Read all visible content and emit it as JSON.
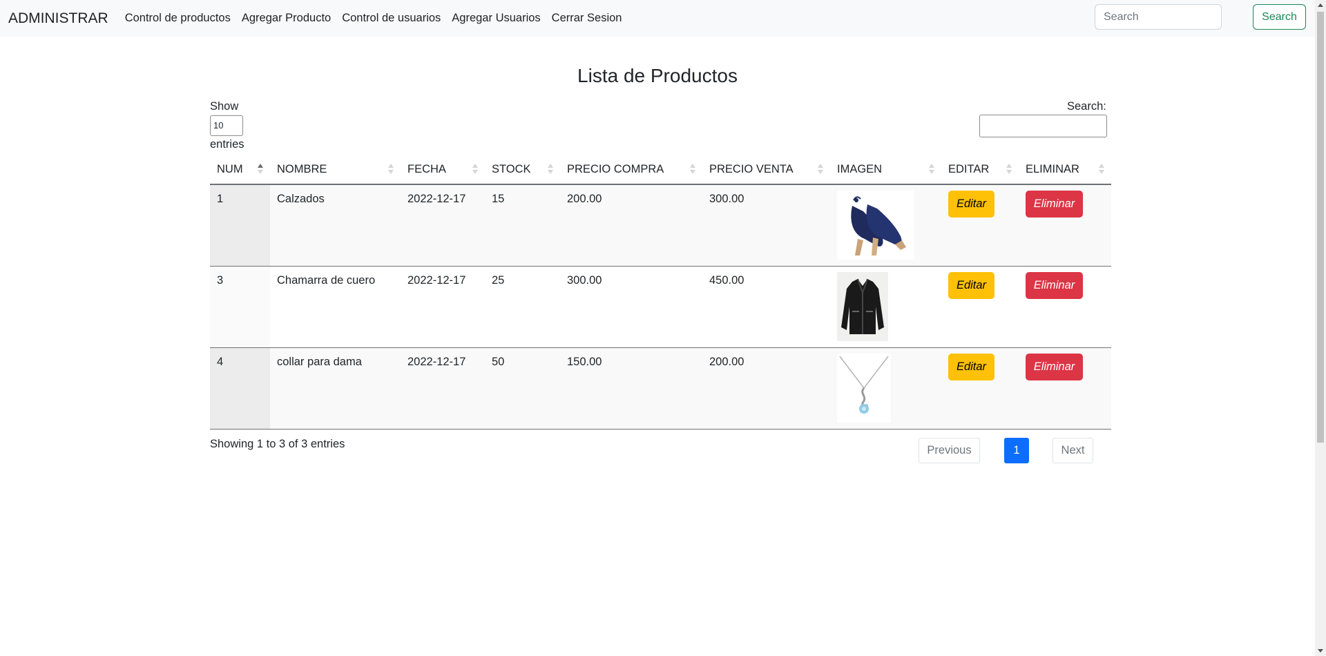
{
  "navbar": {
    "brand": "ADMINISTRAR",
    "links": [
      "Control de productos",
      "Agregar Producto",
      "Control de usuarios",
      "Agregar Usuarios",
      "Cerrar Sesion"
    ],
    "search_placeholder": "Search",
    "search_button": "Search"
  },
  "page": {
    "title": "Lista de Productos"
  },
  "datatable": {
    "length_label_before": "Show",
    "length_value": "10",
    "length_label_after": "entries",
    "search_label": "Search:",
    "columns": [
      "NUM",
      "NOMBRE",
      "FECHA",
      "STOCK",
      "PRECIO COMPRA",
      "PRECIO VENTA",
      "IMAGEN",
      "EDITAR",
      "ELIMINAR"
    ],
    "sorted_column": "NUM",
    "sort_direction": "ascending",
    "rows": [
      {
        "num": "1",
        "nombre": "Calzados",
        "fecha": "2022-12-17",
        "stock": "15",
        "precio_compra": "200.00",
        "precio_venta": "300.00",
        "image_icon": "high-heel-shoes-icon",
        "edit": "Editar",
        "delete": "Eliminar"
      },
      {
        "num": "3",
        "nombre": "Chamarra de cuero",
        "fecha": "2022-12-17",
        "stock": "25",
        "precio_compra": "300.00",
        "precio_venta": "450.00",
        "image_icon": "leather-jacket-icon",
        "edit": "Editar",
        "delete": "Eliminar"
      },
      {
        "num": "4",
        "nombre": "collar para dama",
        "fecha": "2022-12-17",
        "stock": "50",
        "precio_compra": "150.00",
        "precio_venta": "200.00",
        "image_icon": "necklace-icon",
        "edit": "Editar",
        "delete": "Eliminar"
      }
    ],
    "info": "Showing 1 to 3 of 3 entries",
    "pagination": {
      "previous": "Previous",
      "current": "1",
      "next": "Next"
    }
  },
  "colors": {
    "navbar_bg": "#f8f9fa",
    "edit_button": "#ffc107",
    "delete_button": "#dc3545",
    "page_active": "#0d6efd",
    "search_button": "#198754"
  }
}
